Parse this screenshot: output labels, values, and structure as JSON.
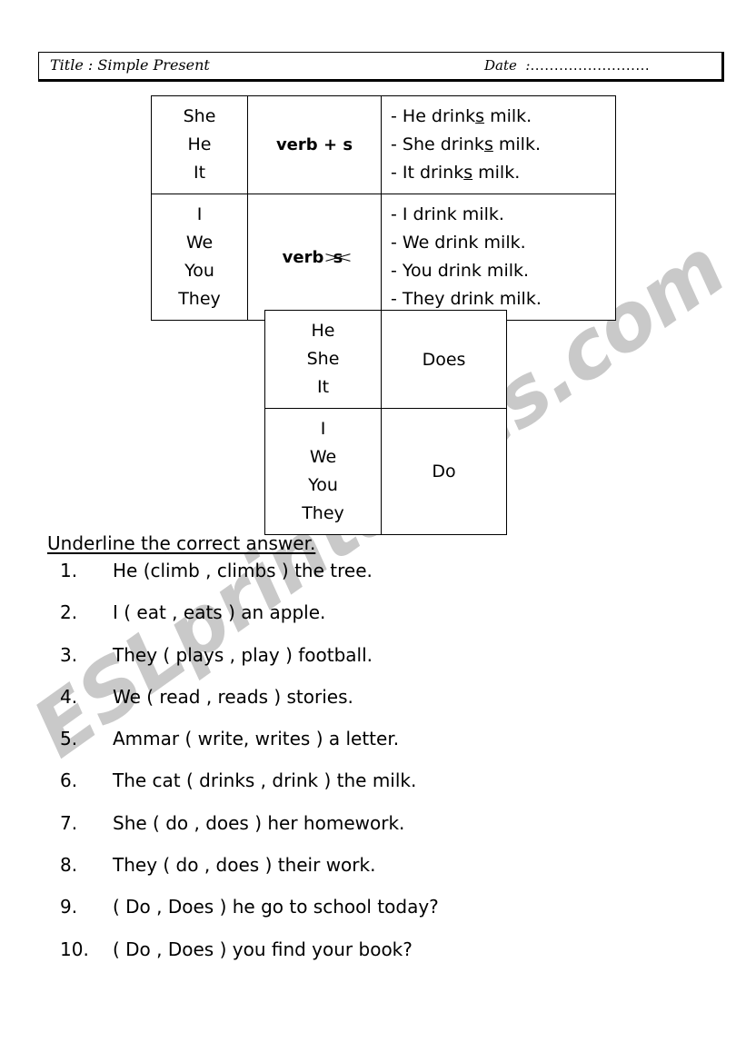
{
  "header": {
    "title": "Title : Simple Present",
    "date_label": "Date",
    "date_colon": ":",
    "date_dots": "........................."
  },
  "table_persons": {
    "rows": [
      {
        "pronouns": [
          "She",
          "He",
          "It"
        ],
        "rule_prefix": "verb",
        "rule_operator": "+",
        "rule_suffix": "s",
        "rule_struck": false,
        "examples": [
          {
            "dash": "-",
            "before": "He drink",
            "underlined": "s",
            "after": " milk."
          },
          {
            "dash": "-",
            "before": "She drink",
            "underlined": "s",
            "after": " milk."
          },
          {
            "dash": "-",
            "before": "It drink",
            "underlined": "s",
            "after": " milk."
          }
        ]
      },
      {
        "pronouns": [
          "I",
          "We",
          "You",
          "They"
        ],
        "rule_prefix": "verb",
        "rule_operator": "",
        "rule_suffix": "s",
        "rule_struck": true,
        "examples": [
          {
            "dash": "-",
            "before": "I drink milk.",
            "underlined": "",
            "after": ""
          },
          {
            "dash": "-",
            "before": "We drink milk.",
            "underlined": "",
            "after": ""
          },
          {
            "dash": "-",
            "before": "You drink milk.",
            "underlined": "",
            "after": ""
          },
          {
            "dash": "-",
            "before": "They drink milk.",
            "underlined": "",
            "after": ""
          }
        ]
      }
    ]
  },
  "table_doaux": {
    "rows": [
      {
        "pronouns": [
          "He",
          "She",
          "It"
        ],
        "auxiliary": "Does"
      },
      {
        "pronouns": [
          "I",
          "We",
          "You",
          "They"
        ],
        "auxiliary": "Do"
      }
    ]
  },
  "instruction": "Underline the correct answer.",
  "questions": [
    {
      "number": "1.",
      "text": "He (climb , climbs ) the tree."
    },
    {
      "number": "2.",
      "text": "I ( eat , eats ) an apple."
    },
    {
      "number": "3.",
      "text": "They ( plays , play ) football."
    },
    {
      "number": "4.",
      "text": "We ( read , reads ) stories."
    },
    {
      "number": "5.",
      "text": "Ammar ( write, writes ) a letter."
    },
    {
      "number": "6.",
      "text": "The cat ( drinks , drink ) the milk."
    },
    {
      "number": "7.",
      "text": "She ( do , does ) her homework."
    },
    {
      "number": "8.",
      "text": "They ( do , does ) their work."
    },
    {
      "number": "9.",
      "text": "( Do , Does ) he go to school today?"
    },
    {
      "number": "10.",
      "text": "( Do , Does ) you find your book?"
    }
  ],
  "watermark": {
    "text": "ESLprintables.com",
    "color": "#c9c9c9"
  }
}
